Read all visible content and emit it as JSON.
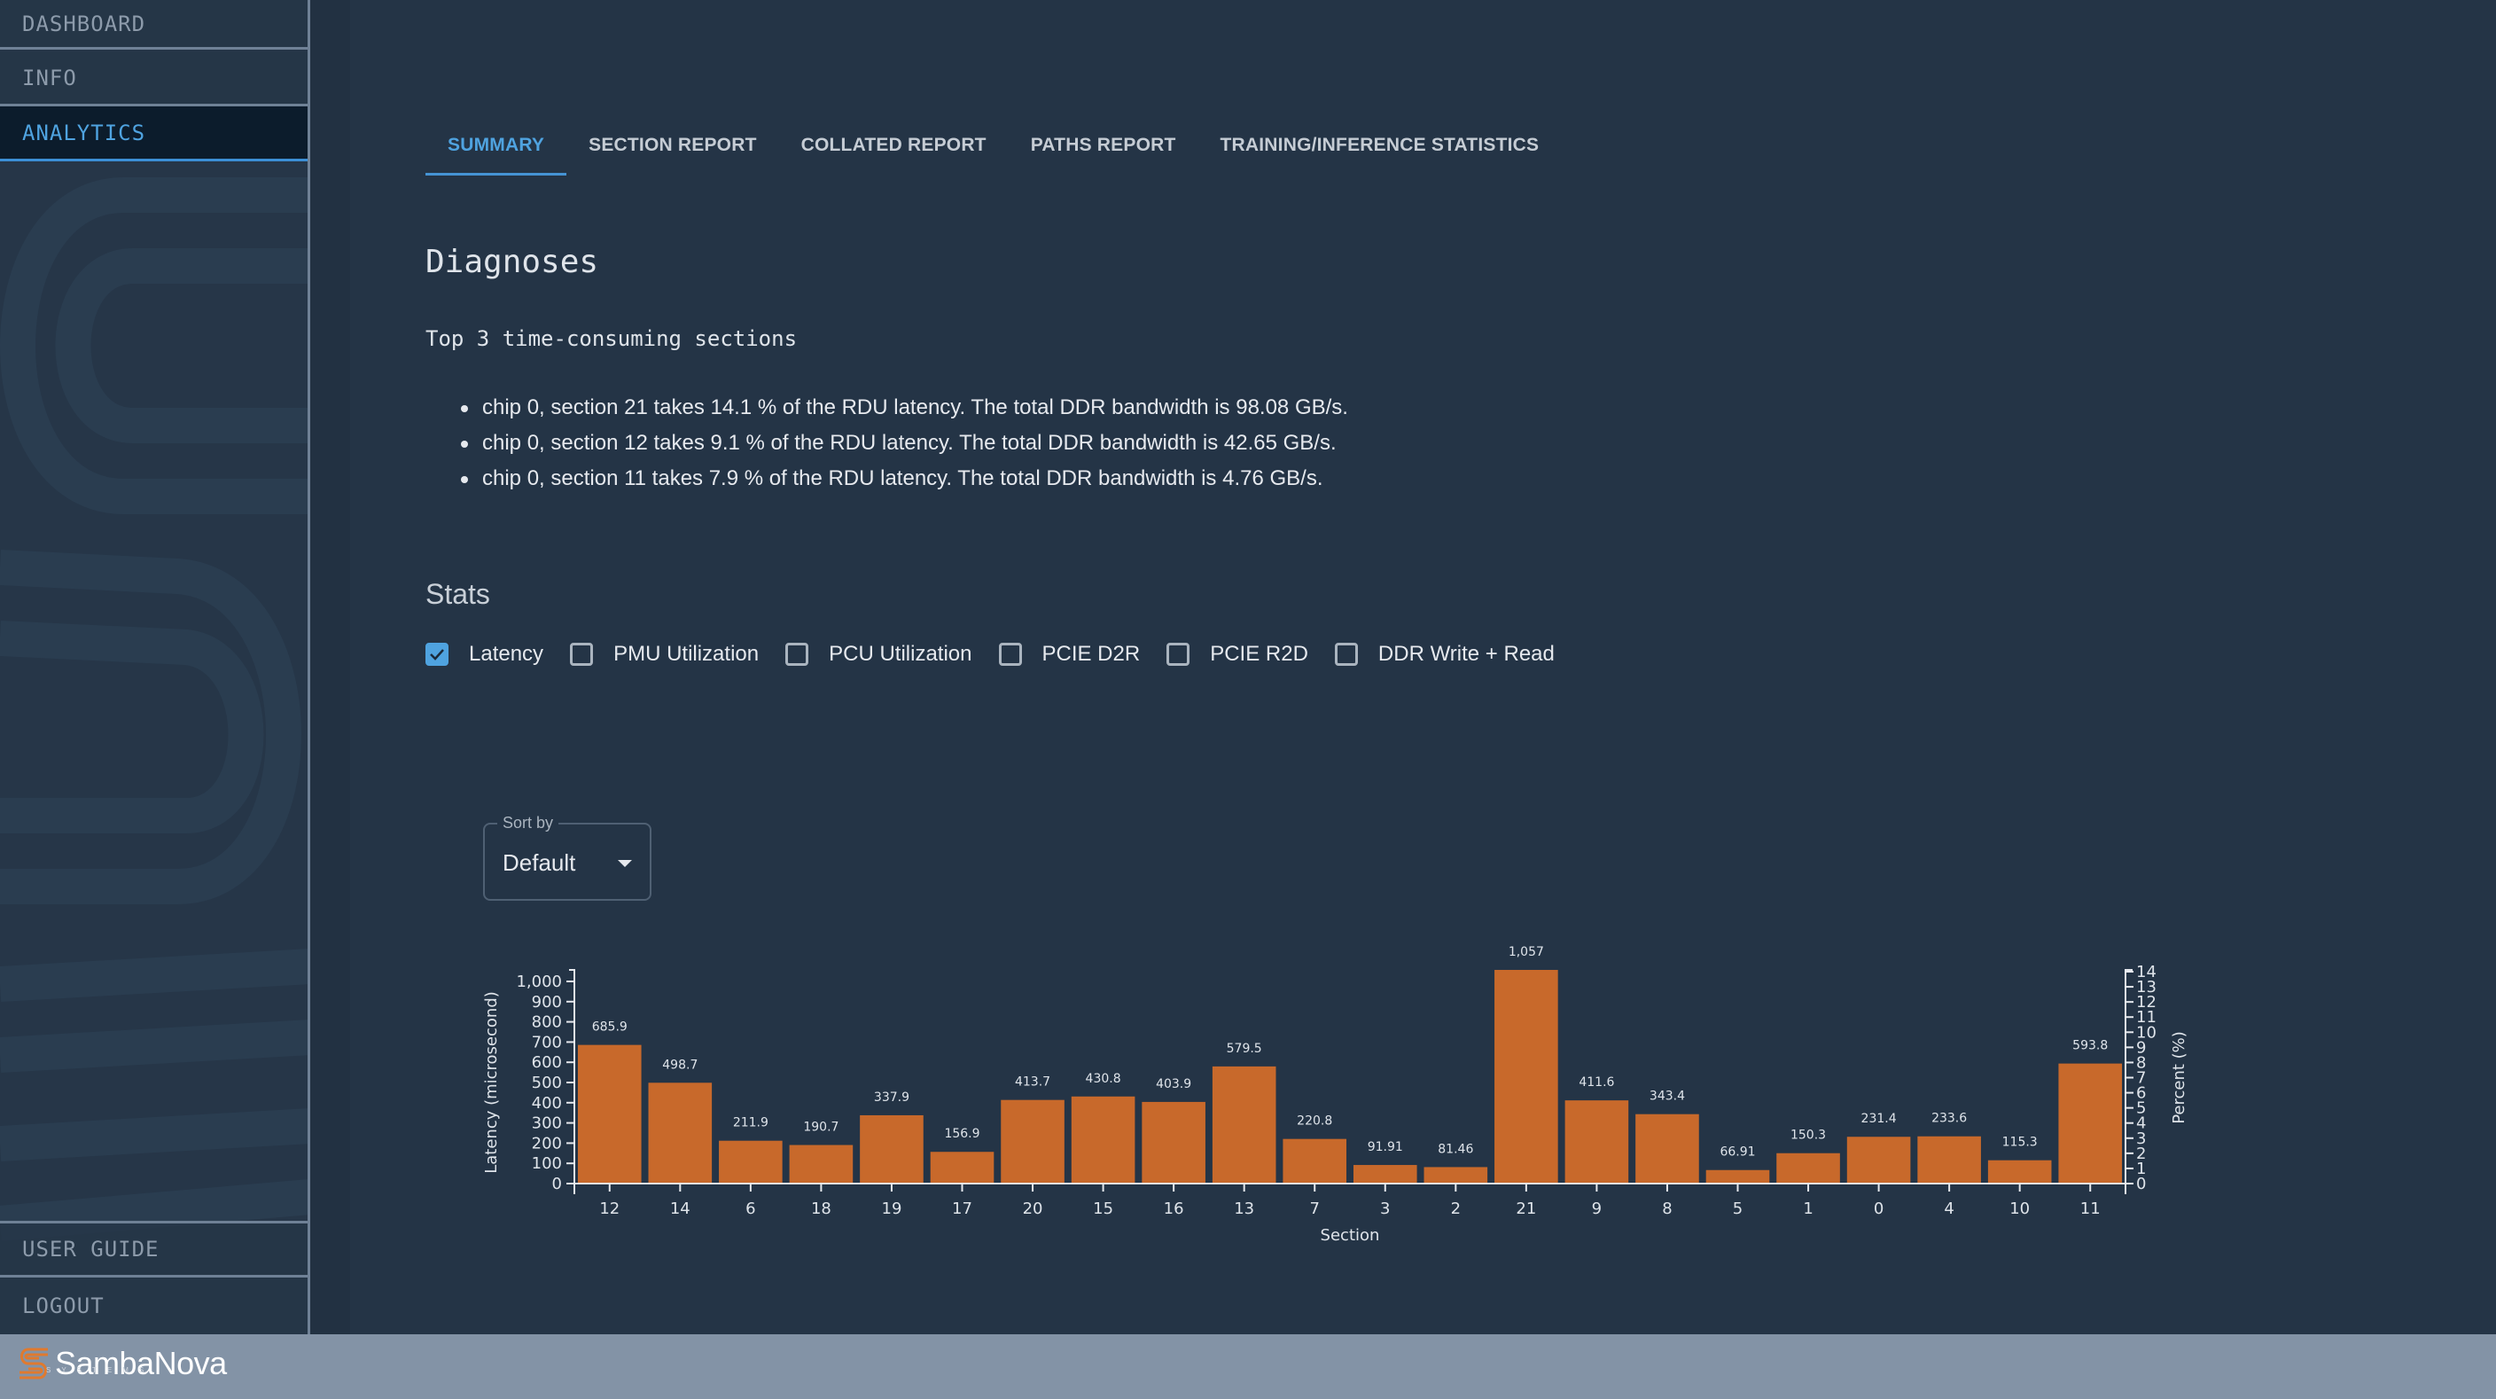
{
  "sidebar": {
    "top_items": [
      {
        "label": "DASHBOARD",
        "active": false
      },
      {
        "label": "INFO",
        "active": false
      },
      {
        "label": "ANALYTICS",
        "active": true
      }
    ],
    "bottom_items": [
      {
        "label": "USER GUIDE"
      },
      {
        "label": "LOGOUT"
      }
    ]
  },
  "tabs": [
    {
      "label": "SUMMARY",
      "active": true
    },
    {
      "label": "SECTION REPORT",
      "active": false
    },
    {
      "label": "COLLATED REPORT",
      "active": false
    },
    {
      "label": "PATHS REPORT",
      "active": false
    },
    {
      "label": "TRAINING/INFERENCE STATISTICS",
      "active": false
    }
  ],
  "diagnoses": {
    "title": "Diagnoses",
    "subtitle": "Top 3 time-consuming sections",
    "items": [
      "chip 0, section 21 takes 14.1 % of the RDU latency. The total DDR bandwidth is 98.08 GB/s.",
      "chip 0, section 12 takes 9.1 % of the RDU latency. The total DDR bandwidth is 42.65 GB/s.",
      "chip 0, section 11 takes 7.9 % of the RDU latency. The total DDR bandwidth is 4.76 GB/s."
    ]
  },
  "stats": {
    "title": "Stats",
    "checkboxes": [
      {
        "label": "Latency",
        "checked": true
      },
      {
        "label": "PMU Utilization",
        "checked": false
      },
      {
        "label": "PCU Utilization",
        "checked": false
      },
      {
        "label": "PCIE D2R",
        "checked": false
      },
      {
        "label": "PCIE R2D",
        "checked": false
      },
      {
        "label": "DDR Write + Read",
        "checked": false
      }
    ],
    "sort": {
      "label": "Sort by",
      "value": "Default"
    }
  },
  "chart_data": {
    "type": "bar",
    "title": "",
    "xlabel": "Section",
    "ylabel": "Latency (microsecond)",
    "y2label": "Percent (%)",
    "categories": [
      "12",
      "14",
      "6",
      "18",
      "19",
      "17",
      "20",
      "15",
      "16",
      "13",
      "7",
      "3",
      "2",
      "21",
      "9",
      "8",
      "5",
      "1",
      "0",
      "4",
      "10",
      "11"
    ],
    "values": [
      685.9,
      498.7,
      211.9,
      190.7,
      337.9,
      156.9,
      413.7,
      430.8,
      403.9,
      579.5,
      220.8,
      91.91,
      81.46,
      1057,
      411.6,
      343.4,
      66.91,
      150.3,
      231.4,
      233.6,
      115.3,
      593.8
    ],
    "value_labels": [
      "685.9",
      "498.7",
      "211.9",
      "190.7",
      "337.9",
      "156.9",
      "413.7",
      "430.8",
      "403.9",
      "579.5",
      "220.8",
      "91.91",
      "81.46",
      "1,057",
      "411.6",
      "343.4",
      "66.91",
      "150.3",
      "231.4",
      "233.6",
      "115.3",
      "593.8"
    ],
    "ylim": [
      0,
      1000
    ],
    "yticks": [
      "0",
      "100",
      "200",
      "300",
      "400",
      "500",
      "600",
      "700",
      "800",
      "900",
      "1,000"
    ],
    "y2lim": [
      0,
      14
    ],
    "y2ticks": [
      "0",
      "1",
      "2",
      "3",
      "4",
      "5",
      "6",
      "7",
      "8",
      "9",
      "10",
      "11",
      "12",
      "13",
      "14"
    ],
    "bar_color": "#c8692b",
    "grid": false,
    "legend": "none"
  },
  "footer": {
    "brand": "SambaNova",
    "brand_sub": "SYSTEMS",
    "brand_color": "#e07a2e"
  }
}
